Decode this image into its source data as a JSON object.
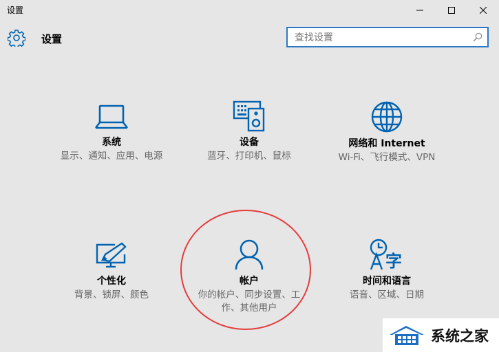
{
  "window": {
    "title": "设置"
  },
  "header": {
    "title": "设置"
  },
  "search": {
    "placeholder": "查找设置"
  },
  "tiles": [
    {
      "name": "系统",
      "desc": "显示、通知、应用、电源",
      "icon": "laptop-icon"
    },
    {
      "name": "设备",
      "desc": "蓝牙、打印机、鼠标",
      "icon": "devices-icon"
    },
    {
      "name": "网络和 Internet",
      "desc": "Wi-Fi、飞行模式、VPN",
      "icon": "globe-icon"
    },
    {
      "name": "个性化",
      "desc": "背景、锁屏、颜色",
      "icon": "personalization-icon"
    },
    {
      "name": "帐户",
      "desc": "你的帐户、同步设置、工作、其他用户",
      "icon": "person-icon"
    },
    {
      "name": "时间和语言",
      "desc": "语音、区域、日期",
      "icon": "time-language-icon"
    }
  ],
  "colors": {
    "accent": "#0063b1",
    "highlight_circle": "#e53d3d",
    "search_border": "#2b78c6",
    "background": "#e6e6e6"
  },
  "watermark": {
    "text": "系统之家"
  }
}
